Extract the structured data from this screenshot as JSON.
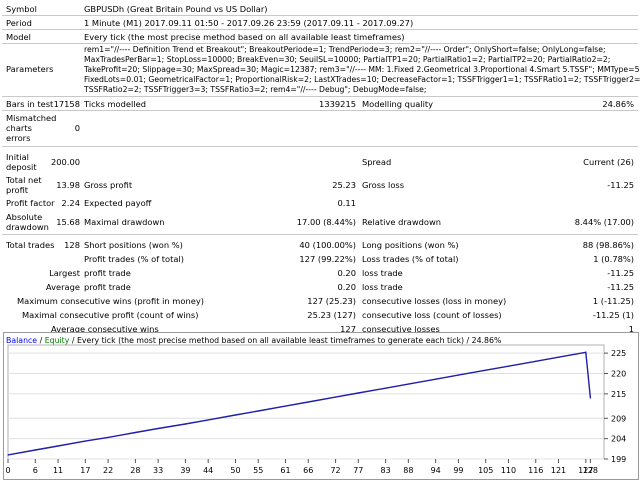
{
  "report": {
    "symbol": {
      "label": "Symbol",
      "value": "GBPUSDh (Great Britain Pound vs US Dollar)"
    },
    "period": {
      "label": "Period",
      "value": "1 Minute (M1) 2017.09.11 01:50 - 2017.09.26 23:59 (2017.09.11 - 2017.09.27)"
    },
    "model": {
      "label": "Model",
      "value": "Every tick (the most precise method based on all available least timeframes)"
    },
    "parameters": {
      "label": "Parameters",
      "lines": [
        "rem1=\"//---- Definition Trend et Breakout\"; BreakoutPeriode=1; TrendPeriode=3; rem2=\"//---- Order\"; OnlyShort=false; OnlyLong=false;",
        "MaxTradesPerBar=1; StopLoss=10000; BreakEven=30; SeuilSL=10000; PartialTP1=20; PartialRatio1=2; PartialTP2=20; PartialRatio2=2;",
        "TakeProfit=20; Slippage=30; MaxSpread=30; Magic=12387; rem3=\"//---- MM: 1.Fixed 2.Geometrical 3.Proportional 4.Smart 5.TSSF\"; MMType=5;",
        "FixedLots=0.01; GeometricalFactor=1; ProportionalRisk=2; LastXTrades=10; DecreaseFactor=1; TSSFTrigger1=1; TSSFRatio1=2; TSSFTrigger2=2;",
        "TSSFRatio2=2; TSSFTrigger3=3; TSSFRatio3=2; rem4=\"//---- Debug\"; DebugMode=false;"
      ]
    },
    "bars_in_test": {
      "label": "Bars in test",
      "value": "17158"
    },
    "ticks_modelled": {
      "label": "Ticks modelled",
      "value": "1339215"
    },
    "modelling_quality": {
      "label": "Modelling quality",
      "value": "24.86%"
    },
    "mismatched": {
      "label_lines": [
        "Mismatched",
        "charts",
        "errors"
      ],
      "value": "0"
    },
    "initial_deposit": {
      "label_lines": [
        "Initial",
        "deposit"
      ],
      "value": "200.00"
    },
    "spread": {
      "label": "Spread",
      "value": "Current (26)"
    },
    "total_net_profit": {
      "label_lines": [
        "Total net",
        "profit"
      ],
      "value": "13.98"
    },
    "gross_profit": {
      "label": "Gross profit",
      "value": "25.23"
    },
    "gross_loss": {
      "label": "Gross loss",
      "value": "-11.25"
    },
    "profit_factor": {
      "label": "Profit factor",
      "value": "2.24"
    },
    "expected_payoff": {
      "label": "Expected payoff",
      "value": "0.11"
    },
    "absolute_drawdown": {
      "label_lines": [
        "Absolute",
        "drawdown"
      ],
      "value": "15.68"
    },
    "maximal_drawdown": {
      "label": "Maximal drawdown",
      "value": "17.00 (8.44%)"
    },
    "relative_drawdown": {
      "label": "Relative drawdown",
      "value": "8.44% (17.00)"
    },
    "total_trades": {
      "label": "Total trades",
      "value": "128"
    },
    "short_positions": {
      "label": "Short positions (won %)",
      "value": "40 (100.00%)"
    },
    "long_positions": {
      "label": "Long positions (won %)",
      "value": "88 (98.86%)"
    },
    "profit_trades": {
      "label": "Profit trades (% of total)",
      "value": "127 (99.22%)"
    },
    "loss_trades": {
      "label": "Loss trades (% of total)",
      "value": "1 (0.78%)"
    },
    "largest_label": "Largest",
    "largest_profit_trade": {
      "label": "profit trade",
      "value": "0.20"
    },
    "largest_loss_trade": {
      "label": "loss trade",
      "value": "-11.25"
    },
    "average_label": "Average",
    "average_profit_trade": {
      "label": "profit trade",
      "value": "0.20"
    },
    "average_loss_trade": {
      "label": "loss trade",
      "value": "-11.25"
    },
    "max_consec_wins": {
      "label": "Maximum consecutive wins (profit in money)",
      "value": "127 (25.23)"
    },
    "max_consec_losses": {
      "label": "consecutive losses (loss in money)",
      "value": "1 (-11.25)"
    },
    "maximal_consec_profit": {
      "label": "Maximal consecutive profit (count of wins)",
      "value": "25.23 (127)"
    },
    "maximal_consec_loss": {
      "label": "consecutive loss (count of losses)",
      "value": "-11.25 (1)"
    },
    "average_consec_wins": {
      "label": "Average consecutive wins",
      "value": "127"
    },
    "average_consec_losses": {
      "label": "consecutive losses",
      "value": "1"
    }
  },
  "chart_header": {
    "balance": "Balance",
    "sep1": " / ",
    "equity": "Equity",
    "rest": " / Every tick (the most precise method based on all available least timeframes to generate each tick) / 24.86%",
    "balance_color": "#0000ff",
    "equity_color": "#008000"
  },
  "chart_data": {
    "type": "line",
    "xlabel": "",
    "ylabel": "",
    "x_ticks": [
      "0",
      "6",
      "11",
      "17",
      "22",
      "28",
      "33",
      "39",
      "44",
      "50",
      "55",
      "61",
      "66",
      "72",
      "77",
      "83",
      "88",
      "94",
      "99",
      "105",
      "110",
      "116",
      "121",
      "127",
      "128"
    ],
    "y_ticks": [
      "225",
      "220",
      "215",
      "209",
      "204",
      "199"
    ],
    "ylim": [
      199,
      227
    ],
    "xlim": [
      0,
      131
    ],
    "line_color": "#1f1fa8",
    "series": [
      {
        "x": [
          0,
          6,
          11,
          17,
          22,
          28,
          33,
          39,
          44,
          50,
          55,
          61,
          66,
          72,
          77,
          83,
          88,
          94,
          99,
          105,
          110,
          116,
          121,
          127,
          128
        ],
        "y": [
          200.0,
          201.2,
          202.2,
          203.4,
          204.3,
          205.5,
          206.5,
          207.6,
          208.6,
          209.8,
          210.8,
          212.0,
          213.0,
          214.2,
          215.2,
          216.4,
          217.4,
          218.6,
          219.6,
          220.8,
          221.8,
          223.0,
          224.0,
          225.2,
          213.98
        ]
      }
    ]
  }
}
